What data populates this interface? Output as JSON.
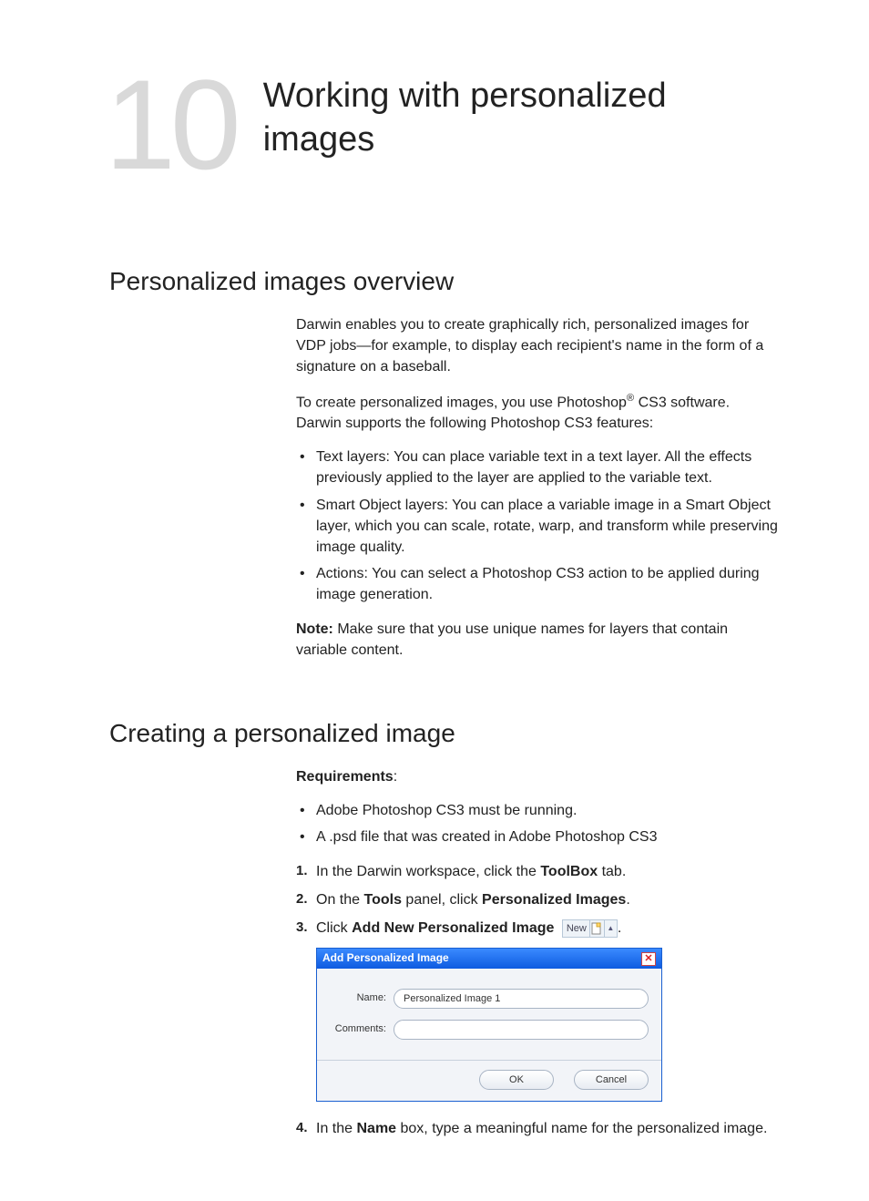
{
  "chapter": {
    "number": "10",
    "title": "Working with personalized images"
  },
  "section1": {
    "title": "Personalized images overview",
    "para1": "Darwin enables you to create graphically rich, personalized images for VDP jobs—for example, to display each recipient's name in the form of a signature on a baseball.",
    "para2_a": "To create personalized images, you use Photoshop",
    "para2_sup": "®",
    "para2_b": " CS3 software. Darwin supports the following Photoshop CS3 features:",
    "bullets": [
      "Text layers: You can place variable text in a text layer. All the effects previously applied to the layer are applied to the variable text.",
      "Smart Object layers: You can place a variable image in a Smart Object layer, which you can scale, rotate, warp, and transform while preserving image quality.",
      "Actions: You can select a Photoshop CS3 action to be applied during image generation."
    ],
    "note_label": "Note:",
    "note_text": " Make sure that you use unique names for layers that contain variable content."
  },
  "section2": {
    "title": "Creating a personalized image",
    "req_label": "Requirements",
    "req_colon": ":",
    "req_bullets": [
      "Adobe Photoshop CS3 must be running.",
      "A .psd file that was created in Adobe Photoshop CS3"
    ],
    "step1_a": "In the Darwin workspace, click the ",
    "step1_bold": "ToolBox",
    "step1_b": " tab.",
    "step2_a": "On the ",
    "step2_bold1": "Tools",
    "step2_b": " panel, click ",
    "step2_bold2": "Personalized Images",
    "step2_c": ".",
    "step3_a": "Click ",
    "step3_bold": "Add New Personalized Image",
    "step3_end": ".",
    "new_button_label": "New",
    "step4_a": "In the ",
    "step4_bold": "Name",
    "step4_b": " box, type a meaningful name for the personalized image."
  },
  "dialog": {
    "title": "Add Personalized Image",
    "name_label": "Name:",
    "name_value": "Personalized Image 1",
    "comments_label": "Comments:",
    "comments_value": "",
    "ok": "OK",
    "cancel": "Cancel"
  }
}
